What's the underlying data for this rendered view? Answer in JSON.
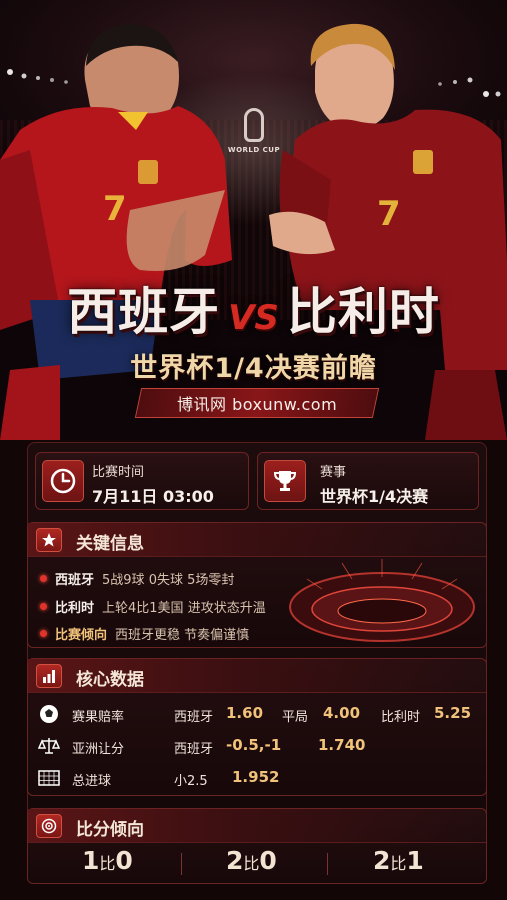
{
  "hero": {
    "team_a": "西班牙",
    "vs": "VS",
    "team_b": "比利时",
    "subtitle": "世界杯1/4决赛前瞻",
    "site": "博讯网 boxunw.com",
    "logo_text": "WORLD CUP"
  },
  "match_time": {
    "label": "比赛时间",
    "value": "7月11日 03:00",
    "icon": "clock-icon"
  },
  "event": {
    "label": "赛事",
    "value": "世界杯1/4决赛",
    "icon": "trophy-icon"
  },
  "key_info": {
    "title": "关键信息",
    "icon": "star-icon",
    "items": [
      {
        "team": "西班牙",
        "detail": "5战9球 0失球 5场零封"
      },
      {
        "team": "比利时",
        "detail": "上轮4比1美国 进攻状态升温"
      },
      {
        "team": "比赛倾向",
        "detail": "西班牙更稳 节奏偏谨慎"
      }
    ]
  },
  "core_data": {
    "title": "核心数据",
    "icon": "bar-chart-icon",
    "rows": [
      {
        "name": "赛果赔率",
        "icon": "soccer-ball-icon",
        "l1": "西班牙",
        "v1": "1.60",
        "l2": "平局",
        "v2": "4.00",
        "l3": "比利时",
        "v3": "5.25"
      },
      {
        "name": "亚洲让分",
        "icon": "scale-icon",
        "l1": "西班牙",
        "v1": "-0.5,-1",
        "v2": "1.740"
      },
      {
        "name": "总进球",
        "icon": "goal-net-icon",
        "l1": "小2.5",
        "v1": "1.952"
      }
    ]
  },
  "score_trend": {
    "title": "比分倾向",
    "icon": "target-icon",
    "scores": [
      {
        "a": "1",
        "sep": "比",
        "b": "0"
      },
      {
        "a": "2",
        "sep": "比",
        "b": "0"
      },
      {
        "a": "2",
        "sep": "比",
        "b": "1"
      }
    ]
  },
  "colors": {
    "accent": "#c8231e",
    "gold": "#f0c27a",
    "background": "#120607"
  }
}
